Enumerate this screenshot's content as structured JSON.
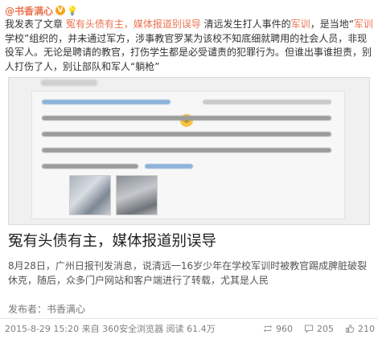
{
  "post": {
    "author": "@书香满心",
    "verified_badge": "V",
    "body_segments": [
      {
        "text": "我发表了文章 ",
        "link": false
      },
      {
        "text": "冤有头债有主，媒体报道别误导",
        "link": true
      },
      {
        "text": " 清远发生打人事件的",
        "link": false
      },
      {
        "text": "军训",
        "link": true
      },
      {
        "text": "，是当地“",
        "link": false
      },
      {
        "text": "军训",
        "link": true
      },
      {
        "text": "学校”组织的，并未通过军方，涉事教官罗某为该校不知底细就聘用的社会人员，非现役军人。无论是聘请的教官，打伤学生都是必受谴责的犯罪行为。但谁出事谁担责，别人打伤了人，别让部队和军人“躺枪”",
        "link": false
      }
    ],
    "embed": {
      "caption_partial": "儿听了使心软了。",
      "blurred_label": "网页链接"
    },
    "headline": "冤有头债有主，媒体报道别误导",
    "summary": "8月28日，广州日报刊发消息，说清远一16岁少年在学校军训时被教官踢成脾脏破裂休克，随后，众多门户网站和客户端进行了转载，尤其是人民",
    "publisher": "发布者：书香满心",
    "meta": "2015-8-29 15:20 来自 360安全浏览器  阅读 61.4万",
    "reposts": "960",
    "comments": "205",
    "likes": "210"
  },
  "colors": {
    "link": "#eb7350",
    "meta": "#808080"
  },
  "icons": [
    "verified-icon",
    "lightbulb-icon",
    "repost-icon",
    "comment-icon",
    "like-icon"
  ]
}
